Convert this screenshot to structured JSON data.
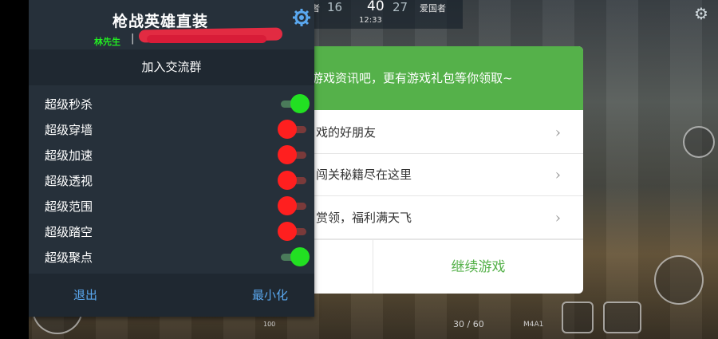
{
  "hud": {
    "team_left": "守护者",
    "score_left": "16",
    "score_center": "40",
    "score_right": "27",
    "team_right": "爱国者",
    "clock": "12:33",
    "ammo": "30 / 60",
    "weapon": "M4A1",
    "hp": "100"
  },
  "dialog": {
    "header": "游戏资讯吧，更有游戏礼包等你领取~",
    "rows": [
      {
        "text": "戏的好朋友"
      },
      {
        "text": "闯关秘籍尽在这里"
      },
      {
        "text": "赏领，福利满天飞"
      }
    ],
    "continue_label": "继续游戏"
  },
  "menu": {
    "title": "枪战英雄直装",
    "author": "林先生",
    "separator": "|",
    "group_label": "加入交流群",
    "items": [
      {
        "label": "超级秒杀",
        "on": true
      },
      {
        "label": "超级穿墙",
        "on": false
      },
      {
        "label": "超级加速",
        "on": false
      },
      {
        "label": "超级透视",
        "on": false
      },
      {
        "label": "超级范围",
        "on": false
      },
      {
        "label": "超级踏空",
        "on": false
      },
      {
        "label": "超级聚点",
        "on": true
      }
    ],
    "exit_label": "退出",
    "minimize_label": "最小化"
  },
  "colors": {
    "menu_bg": "#26303a",
    "dialog_accent": "#55b14a",
    "toggle_on": "#22e022",
    "toggle_off": "#ff1f1f",
    "bottom_button_text": "#5aa8f0"
  },
  "icons": {
    "menu_settings": "gear-icon",
    "game_settings": "gear-icon",
    "row_arrow": "chevron-right-icon"
  }
}
